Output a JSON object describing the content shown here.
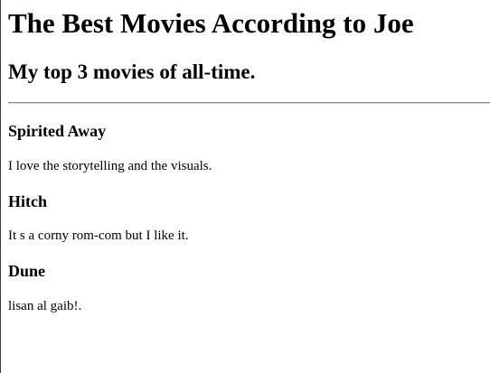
{
  "header": {
    "title": "The Best Movies According to Joe",
    "subtitle": "My top 3 movies of all-time."
  },
  "movies": [
    {
      "title": "Spirited Away",
      "description": "I love the storytelling and the visuals."
    },
    {
      "title": "Hitch",
      "description": "It s a corny rom-com but I like it."
    },
    {
      "title": "Dune",
      "description": "lisan al gaib!."
    }
  ]
}
